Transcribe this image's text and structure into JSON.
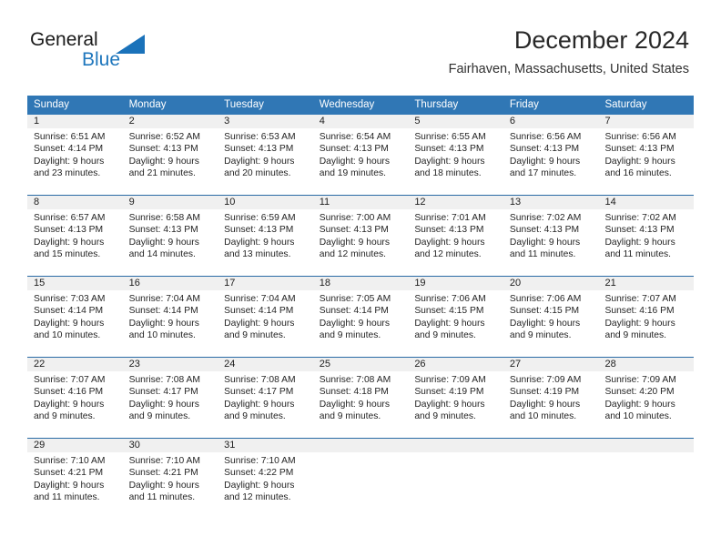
{
  "brand": {
    "word_one": "General",
    "word_two": "Blue",
    "flag_icon": "blue-triangle-flag-icon",
    "accent_color": "#1a72ba"
  },
  "header": {
    "title": "December 2024",
    "subtitle": "Fairhaven, Massachusetts, United States"
  },
  "calendar": {
    "header_background": "#3077b5",
    "daynum_background": "#f0f0f0",
    "row_divider_color": "#2a6ba5",
    "weekdays": [
      "Sunday",
      "Monday",
      "Tuesday",
      "Wednesday",
      "Thursday",
      "Friday",
      "Saturday"
    ],
    "weeks": [
      [
        {
          "day": "1",
          "sunrise": "Sunrise: 6:51 AM",
          "sunset": "Sunset: 4:14 PM",
          "daylight_line1": "Daylight: 9 hours",
          "daylight_line2": "and 23 minutes."
        },
        {
          "day": "2",
          "sunrise": "Sunrise: 6:52 AM",
          "sunset": "Sunset: 4:13 PM",
          "daylight_line1": "Daylight: 9 hours",
          "daylight_line2": "and 21 minutes."
        },
        {
          "day": "3",
          "sunrise": "Sunrise: 6:53 AM",
          "sunset": "Sunset: 4:13 PM",
          "daylight_line1": "Daylight: 9 hours",
          "daylight_line2": "and 20 minutes."
        },
        {
          "day": "4",
          "sunrise": "Sunrise: 6:54 AM",
          "sunset": "Sunset: 4:13 PM",
          "daylight_line1": "Daylight: 9 hours",
          "daylight_line2": "and 19 minutes."
        },
        {
          "day": "5",
          "sunrise": "Sunrise: 6:55 AM",
          "sunset": "Sunset: 4:13 PM",
          "daylight_line1": "Daylight: 9 hours",
          "daylight_line2": "and 18 minutes."
        },
        {
          "day": "6",
          "sunrise": "Sunrise: 6:56 AM",
          "sunset": "Sunset: 4:13 PM",
          "daylight_line1": "Daylight: 9 hours",
          "daylight_line2": "and 17 minutes."
        },
        {
          "day": "7",
          "sunrise": "Sunrise: 6:56 AM",
          "sunset": "Sunset: 4:13 PM",
          "daylight_line1": "Daylight: 9 hours",
          "daylight_line2": "and 16 minutes."
        }
      ],
      [
        {
          "day": "8",
          "sunrise": "Sunrise: 6:57 AM",
          "sunset": "Sunset: 4:13 PM",
          "daylight_line1": "Daylight: 9 hours",
          "daylight_line2": "and 15 minutes."
        },
        {
          "day": "9",
          "sunrise": "Sunrise: 6:58 AM",
          "sunset": "Sunset: 4:13 PM",
          "daylight_line1": "Daylight: 9 hours",
          "daylight_line2": "and 14 minutes."
        },
        {
          "day": "10",
          "sunrise": "Sunrise: 6:59 AM",
          "sunset": "Sunset: 4:13 PM",
          "daylight_line1": "Daylight: 9 hours",
          "daylight_line2": "and 13 minutes."
        },
        {
          "day": "11",
          "sunrise": "Sunrise: 7:00 AM",
          "sunset": "Sunset: 4:13 PM",
          "daylight_line1": "Daylight: 9 hours",
          "daylight_line2": "and 12 minutes."
        },
        {
          "day": "12",
          "sunrise": "Sunrise: 7:01 AM",
          "sunset": "Sunset: 4:13 PM",
          "daylight_line1": "Daylight: 9 hours",
          "daylight_line2": "and 12 minutes."
        },
        {
          "day": "13",
          "sunrise": "Sunrise: 7:02 AM",
          "sunset": "Sunset: 4:13 PM",
          "daylight_line1": "Daylight: 9 hours",
          "daylight_line2": "and 11 minutes."
        },
        {
          "day": "14",
          "sunrise": "Sunrise: 7:02 AM",
          "sunset": "Sunset: 4:13 PM",
          "daylight_line1": "Daylight: 9 hours",
          "daylight_line2": "and 11 minutes."
        }
      ],
      [
        {
          "day": "15",
          "sunrise": "Sunrise: 7:03 AM",
          "sunset": "Sunset: 4:14 PM",
          "daylight_line1": "Daylight: 9 hours",
          "daylight_line2": "and 10 minutes."
        },
        {
          "day": "16",
          "sunrise": "Sunrise: 7:04 AM",
          "sunset": "Sunset: 4:14 PM",
          "daylight_line1": "Daylight: 9 hours",
          "daylight_line2": "and 10 minutes."
        },
        {
          "day": "17",
          "sunrise": "Sunrise: 7:04 AM",
          "sunset": "Sunset: 4:14 PM",
          "daylight_line1": "Daylight: 9 hours",
          "daylight_line2": "and 9 minutes."
        },
        {
          "day": "18",
          "sunrise": "Sunrise: 7:05 AM",
          "sunset": "Sunset: 4:14 PM",
          "daylight_line1": "Daylight: 9 hours",
          "daylight_line2": "and 9 minutes."
        },
        {
          "day": "19",
          "sunrise": "Sunrise: 7:06 AM",
          "sunset": "Sunset: 4:15 PM",
          "daylight_line1": "Daylight: 9 hours",
          "daylight_line2": "and 9 minutes."
        },
        {
          "day": "20",
          "sunrise": "Sunrise: 7:06 AM",
          "sunset": "Sunset: 4:15 PM",
          "daylight_line1": "Daylight: 9 hours",
          "daylight_line2": "and 9 minutes."
        },
        {
          "day": "21",
          "sunrise": "Sunrise: 7:07 AM",
          "sunset": "Sunset: 4:16 PM",
          "daylight_line1": "Daylight: 9 hours",
          "daylight_line2": "and 9 minutes."
        }
      ],
      [
        {
          "day": "22",
          "sunrise": "Sunrise: 7:07 AM",
          "sunset": "Sunset: 4:16 PM",
          "daylight_line1": "Daylight: 9 hours",
          "daylight_line2": "and 9 minutes."
        },
        {
          "day": "23",
          "sunrise": "Sunrise: 7:08 AM",
          "sunset": "Sunset: 4:17 PM",
          "daylight_line1": "Daylight: 9 hours",
          "daylight_line2": "and 9 minutes."
        },
        {
          "day": "24",
          "sunrise": "Sunrise: 7:08 AM",
          "sunset": "Sunset: 4:17 PM",
          "daylight_line1": "Daylight: 9 hours",
          "daylight_line2": "and 9 minutes."
        },
        {
          "day": "25",
          "sunrise": "Sunrise: 7:08 AM",
          "sunset": "Sunset: 4:18 PM",
          "daylight_line1": "Daylight: 9 hours",
          "daylight_line2": "and 9 minutes."
        },
        {
          "day": "26",
          "sunrise": "Sunrise: 7:09 AM",
          "sunset": "Sunset: 4:19 PM",
          "daylight_line1": "Daylight: 9 hours",
          "daylight_line2": "and 9 minutes."
        },
        {
          "day": "27",
          "sunrise": "Sunrise: 7:09 AM",
          "sunset": "Sunset: 4:19 PM",
          "daylight_line1": "Daylight: 9 hours",
          "daylight_line2": "and 10 minutes."
        },
        {
          "day": "28",
          "sunrise": "Sunrise: 7:09 AM",
          "sunset": "Sunset: 4:20 PM",
          "daylight_line1": "Daylight: 9 hours",
          "daylight_line2": "and 10 minutes."
        }
      ],
      [
        {
          "day": "29",
          "sunrise": "Sunrise: 7:10 AM",
          "sunset": "Sunset: 4:21 PM",
          "daylight_line1": "Daylight: 9 hours",
          "daylight_line2": "and 11 minutes."
        },
        {
          "day": "30",
          "sunrise": "Sunrise: 7:10 AM",
          "sunset": "Sunset: 4:21 PM",
          "daylight_line1": "Daylight: 9 hours",
          "daylight_line2": "and 11 minutes."
        },
        {
          "day": "31",
          "sunrise": "Sunrise: 7:10 AM",
          "sunset": "Sunset: 4:22 PM",
          "daylight_line1": "Daylight: 9 hours",
          "daylight_line2": "and 12 minutes."
        },
        {
          "day": "",
          "sunrise": "",
          "sunset": "",
          "daylight_line1": "",
          "daylight_line2": ""
        },
        {
          "day": "",
          "sunrise": "",
          "sunset": "",
          "daylight_line1": "",
          "daylight_line2": ""
        },
        {
          "day": "",
          "sunrise": "",
          "sunset": "",
          "daylight_line1": "",
          "daylight_line2": ""
        },
        {
          "day": "",
          "sunrise": "",
          "sunset": "",
          "daylight_line1": "",
          "daylight_line2": ""
        }
      ]
    ]
  }
}
